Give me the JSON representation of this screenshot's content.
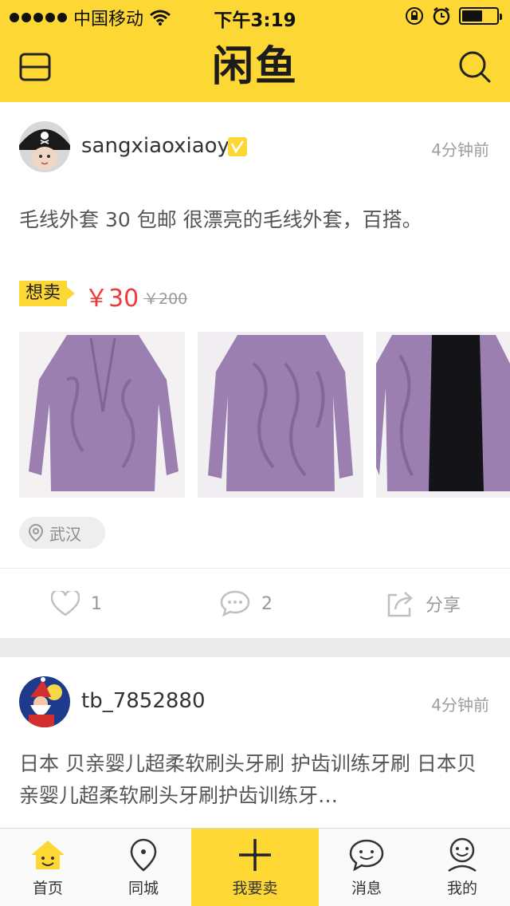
{
  "status_bar": {
    "carrier": "中国移动",
    "time": "下午3:19",
    "battery_level": 0.6
  },
  "header": {
    "logo": "闲鱼",
    "left_icon": "menu-icon",
    "right_icon": "search-icon"
  },
  "feed": [
    {
      "username": "sangxiaoxiaoy",
      "time": "4分钟前",
      "description": "毛线外套 30 包邮 很漂亮的毛线外套，百搭。",
      "tag": "想卖",
      "price": "￥30",
      "original_price": "￥200",
      "location": "武汉",
      "likes": "1",
      "comments": "2",
      "share_label": "分享"
    },
    {
      "username": "tb_7852880",
      "time": "4分钟前",
      "description": "日本 贝亲婴儿超柔软刷头牙刷 护齿训练牙刷 日本贝亲婴儿超柔软刷头牙刷护齿训练牙…"
    }
  ],
  "tabbar": [
    {
      "label": "首页",
      "icon": "home-icon"
    },
    {
      "label": "同城",
      "icon": "location-pin-icon"
    },
    {
      "label": "我要卖",
      "icon": "plus-icon"
    },
    {
      "label": "消息",
      "icon": "message-icon"
    },
    {
      "label": "我的",
      "icon": "profile-icon"
    }
  ],
  "colors": {
    "brand_yellow": "#fdd835",
    "price_red": "#f03a3a",
    "sweater_purple": "#9a7fb0"
  }
}
